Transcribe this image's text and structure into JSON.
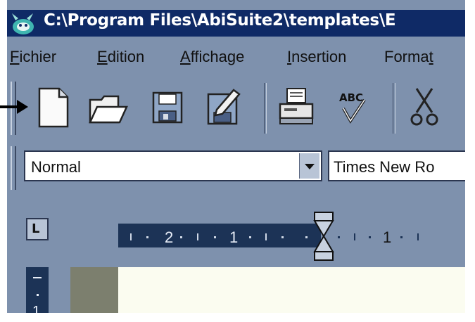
{
  "window": {
    "title": "C:\\Program Files\\AbiSuite2\\templates\\E"
  },
  "menu": {
    "items": [
      {
        "key": "F",
        "rest": "ichier"
      },
      {
        "key": "E",
        "rest": "dition"
      },
      {
        "key": "A",
        "rest": "ffichage"
      },
      {
        "key": "I",
        "rest": "nsertion"
      },
      {
        "pre": "Forma",
        "key": "t",
        "rest": ""
      }
    ]
  },
  "toolbar": {
    "buttons": [
      "new-document-icon",
      "open-folder-icon",
      "save-disk-icon",
      "save-as-icon",
      "print-icon",
      "spellcheck-icon",
      "cut-scissors-icon"
    ],
    "spell_label": "ABC"
  },
  "format": {
    "style_value": "Normal",
    "font_value": "Times New Ro"
  },
  "ruler": {
    "tab_type": "L",
    "labels": [
      "2",
      "1",
      "1"
    ],
    "vertical_label": "1"
  },
  "colors": {
    "titlebar": "#0f2a66",
    "chrome": "#7e91ad",
    "ruler_dark": "#1c3356",
    "page": "#fbfcf0"
  }
}
